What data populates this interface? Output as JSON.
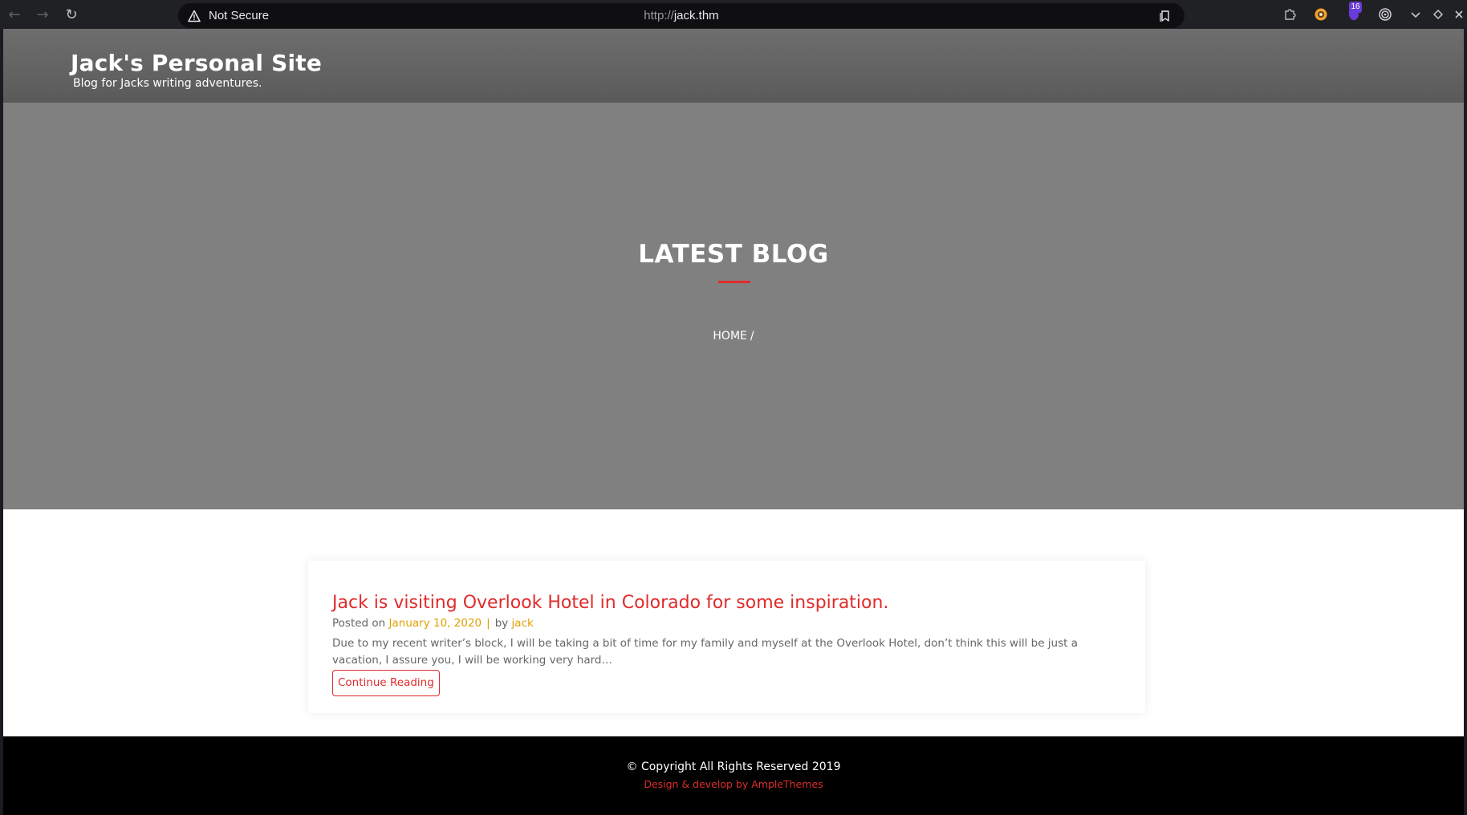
{
  "browser": {
    "security_label": "Not Secure",
    "url_protocol": "http://",
    "url_host": "jack.thm",
    "extension_badge_count": "16",
    "icons": [
      "back-arrow-icon",
      "forward-arrow-icon",
      "reload-icon",
      "warning-icon",
      "bookmark-icon",
      "puzzle-icon",
      "fox-icon",
      "shield-icon",
      "target-icon",
      "chevron-down-icon",
      "diamond-icon",
      "close-icon"
    ]
  },
  "site": {
    "title": "Jack's Personal Site",
    "tagline": "Blog for Jacks writing adventures."
  },
  "hero": {
    "title": "LATEST BLOG",
    "breadcrumb_home": "HOME",
    "breadcrumb_separator": "/"
  },
  "post": {
    "title": "Jack is visiting Overlook Hotel in Colorado for some inspiration.",
    "posted_on_label": "Posted on",
    "date": "January 10, 2020",
    "pipe": "|",
    "by_label": "by",
    "author": "jack",
    "excerpt": "Due to my recent writer’s block, I will be taking a bit of time for my family and myself at the Overlook Hotel, don’t think this will be just a vacation, I assure you, I will be working very hard…",
    "continue_label": "Continue Reading"
  },
  "footer": {
    "copyright": "© Copyright All Rights Reserved 2019",
    "credit": "Design & develop by AmpleThemes"
  },
  "colors": {
    "accent_red": "#e02b2b",
    "meta_orange": "#e0a000",
    "hero_gray": "#808080",
    "header_gray": "#636363",
    "footer_black": "#000000"
  }
}
